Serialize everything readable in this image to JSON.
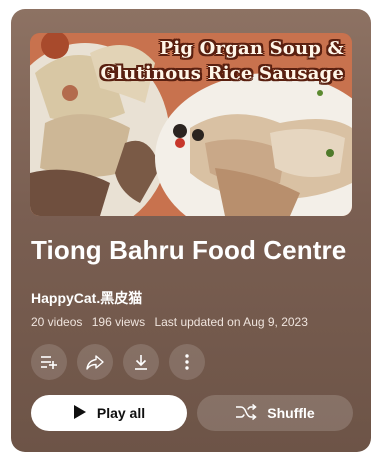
{
  "playlist": {
    "thumbnail_caption_line1": "Pig Organ Soup &",
    "thumbnail_caption_line2": "Glutinous Rice Sausage",
    "title": "Tiong Bahru Food Centre",
    "channel": "HappyCat.黑皮猫",
    "video_count": "20 videos",
    "view_count": "196 views",
    "last_updated": "Last updated on Aug 9, 2023"
  },
  "actions": {
    "icons": [
      "add-to-queue-icon",
      "share-icon",
      "download-icon",
      "more-vert-icon"
    ],
    "play_all_label": "Play all",
    "shuffle_label": "Shuffle"
  },
  "colors": {
    "card_background": "#7d6355",
    "play_button_background": "#ffffff",
    "shuffle_button_background": "#a08d82"
  }
}
